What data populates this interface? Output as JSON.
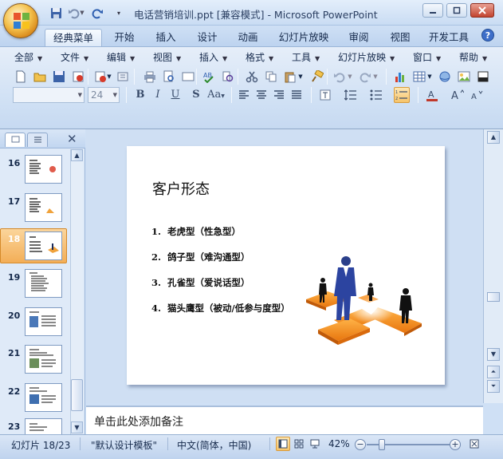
{
  "window": {
    "title": "电话营销培训.ppt [兼容模式] - Microsoft PowerPoint",
    "accent": "#2b5797",
    "title_bar_color": "#c9dcf3"
  },
  "quick_access": [
    "save-icon",
    "undo-icon",
    "redo-icon",
    "customize-icon"
  ],
  "tabs": [
    {
      "label": "经典菜单",
      "active": true
    },
    {
      "label": "开始"
    },
    {
      "label": "插入"
    },
    {
      "label": "设计"
    },
    {
      "label": "动画"
    },
    {
      "label": "幻灯片放映"
    },
    {
      "label": "审阅"
    },
    {
      "label": "视图"
    },
    {
      "label": "开发工具"
    }
  ],
  "menus": [
    "全部",
    "文件",
    "编辑",
    "视图",
    "插入",
    "格式",
    "工具",
    "幻灯片放映",
    "窗口",
    "帮助"
  ],
  "font": {
    "name": "",
    "size": "24"
  },
  "thumbnails": [
    {
      "num": "16"
    },
    {
      "num": "17"
    },
    {
      "num": "18",
      "selected": true
    },
    {
      "num": "19"
    },
    {
      "num": "20"
    },
    {
      "num": "21"
    },
    {
      "num": "22"
    },
    {
      "num": "23"
    }
  ],
  "slide": {
    "title": "客户形态",
    "bullets": [
      {
        "num": "1.",
        "text": "老虎型（性急型）"
      },
      {
        "num": "2.",
        "text": "鸽子型（难沟通型）"
      },
      {
        "num": "3.",
        "text": "孔雀型（爱说话型）"
      },
      {
        "num": "4.",
        "text": "猫头鹰型（被动/低参与度型）"
      }
    ]
  },
  "notes": {
    "placeholder": "单击此处添加备注"
  },
  "status": {
    "slide": "幻灯片 18/23",
    "theme": "\"默认设计模板\"",
    "language": "中文(简体，中国)",
    "zoom": "42%"
  }
}
